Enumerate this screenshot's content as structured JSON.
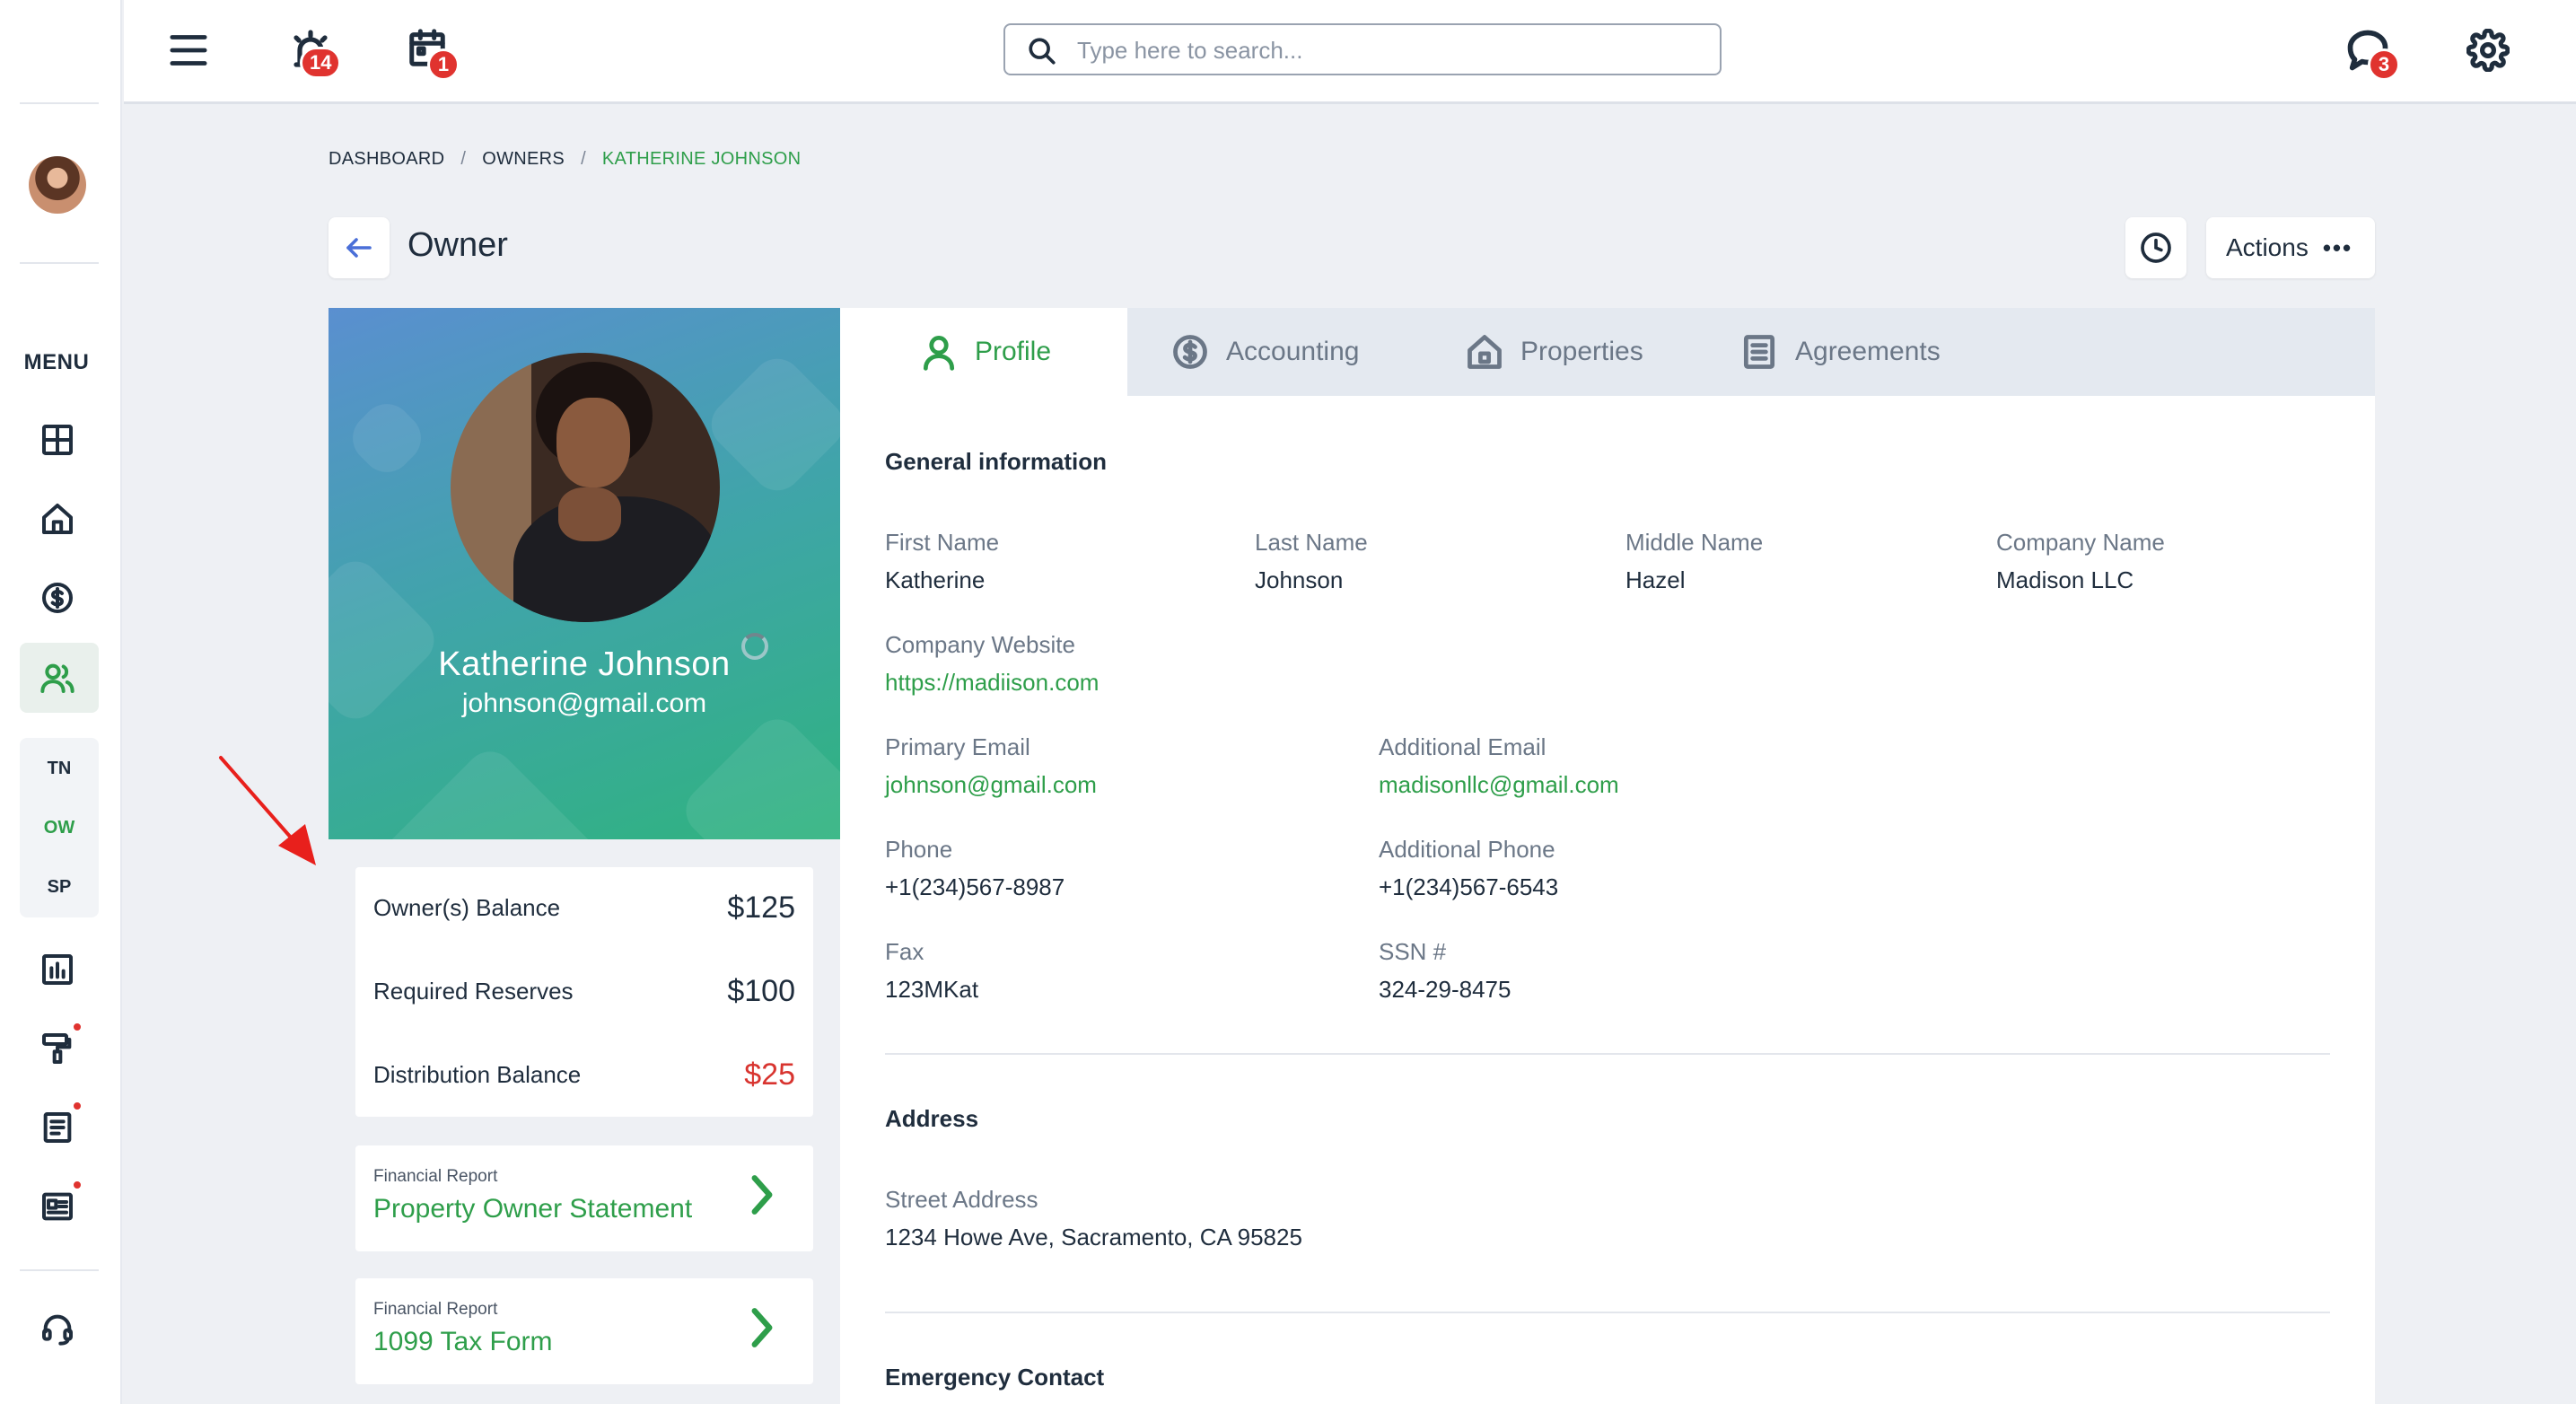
{
  "sidebar": {
    "menu_label": "MENU",
    "items": [
      {
        "name": "dashboard-icon"
      },
      {
        "name": "home-icon"
      },
      {
        "name": "dollar-icon"
      },
      {
        "name": "users-icon",
        "active": true
      },
      {
        "name": "chart-icon"
      },
      {
        "name": "paint-roller-icon",
        "dot": true
      },
      {
        "name": "document-icon",
        "dot": true
      },
      {
        "name": "newspaper-icon",
        "dot": true
      },
      {
        "name": "headset-icon"
      }
    ],
    "sub_items": [
      {
        "label": "TN",
        "color": "#1f2d3d"
      },
      {
        "label": "OW",
        "color": "#2e9e4a"
      },
      {
        "label": "SP",
        "color": "#1f2d3d"
      }
    ]
  },
  "topbar": {
    "alarm_badge": "14",
    "calendar_badge": "1",
    "chat_badge": "3",
    "search_placeholder": "Type here to search..."
  },
  "breadcrumb": {
    "items": [
      "DASHBOARD",
      "OWNERS"
    ],
    "current": "KATHERINE JOHNSON",
    "separator": "/"
  },
  "header": {
    "title": "Owner",
    "actions_label": "Actions",
    "actions_dots": "•••"
  },
  "profile": {
    "name": "Katherine Johnson",
    "email": "johnson@gmail.com"
  },
  "balances": [
    {
      "label": "Owner(s) Balance",
      "value": "$125"
    },
    {
      "label": "Required Reserves",
      "value": "$100"
    },
    {
      "label": "Distribution Balance",
      "value": "$25",
      "negative": true
    }
  ],
  "reports": [
    {
      "kicker": "Financial Report",
      "title": "Property Owner Statement"
    },
    {
      "kicker": "Financial Report",
      "title": "1099 Tax Form"
    }
  ],
  "tabs": [
    {
      "label": "Profile",
      "icon": "user-icon",
      "active": true
    },
    {
      "label": "Accounting",
      "icon": "dollar-circle-icon"
    },
    {
      "label": "Properties",
      "icon": "house-icon"
    },
    {
      "label": "Agreements",
      "icon": "agreement-doc-icon"
    }
  ],
  "general": {
    "title": "General information",
    "first_name_label": "First Name",
    "first_name": "Katherine",
    "last_name_label": "Last Name",
    "last_name": "Johnson",
    "middle_name_label": "Middle Name",
    "middle_name": "Hazel",
    "company_name_label": "Company Name",
    "company_name": "Madison LLC",
    "website_label": "Company Website",
    "website": "https://madiison.com",
    "primary_email_label": "Primary Email",
    "primary_email": "johnson@gmail.com",
    "additional_email_label": "Additional Email",
    "additional_email": "madisonllc@gmail.com",
    "phone_label": "Phone",
    "phone": "+1(234)567-8987",
    "additional_phone_label": "Additional Phone",
    "additional_phone": "+1(234)567-6543",
    "fax_label": "Fax",
    "fax": "123MKat",
    "ssn_label": "SSN #",
    "ssn": "324-29-8475"
  },
  "address": {
    "title": "Address",
    "street_label": "Street Address",
    "street": "1234 Howe Ave, Sacramento, CA 95825"
  },
  "emergency": {
    "title": "Emergency Contact"
  },
  "colors": {
    "accent_green": "#2e9e4a",
    "negative_red": "#d8342f",
    "badge_red": "#e0332f",
    "annotation_arrow": "#e8201c"
  }
}
